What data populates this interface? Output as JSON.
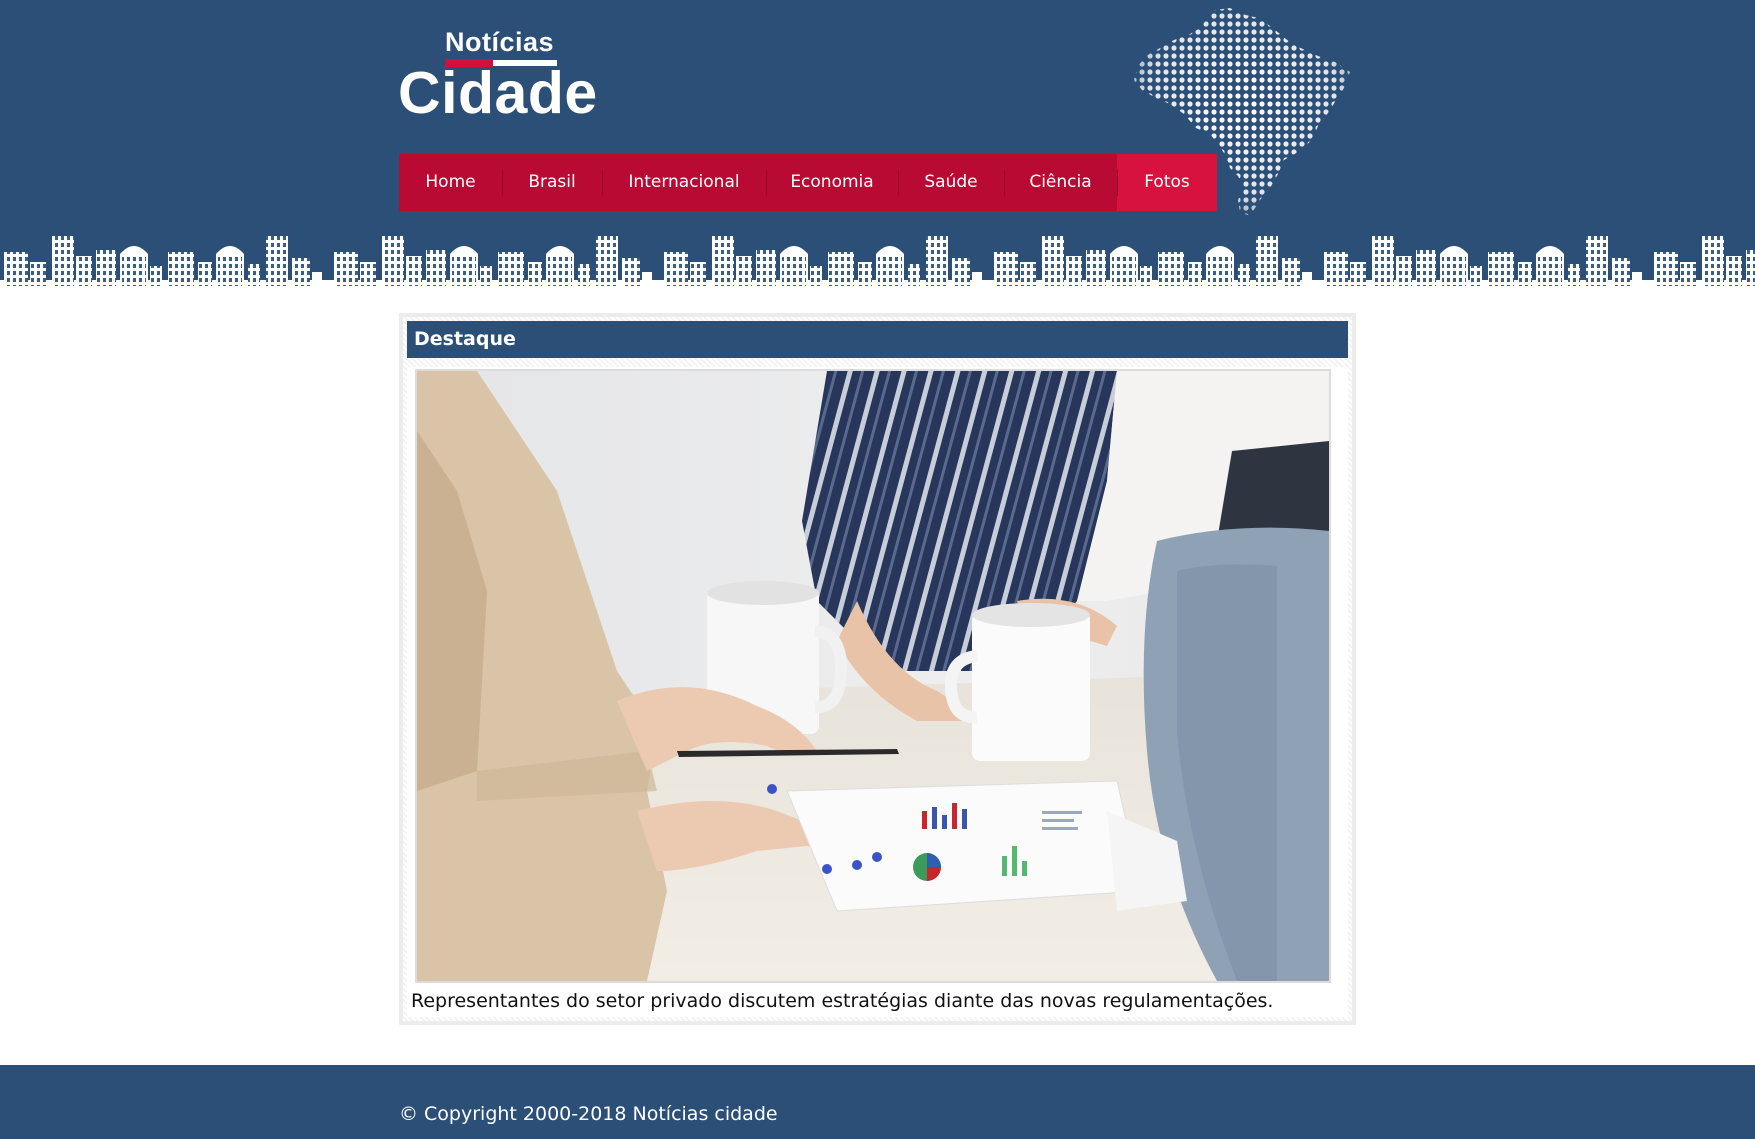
{
  "colors": {
    "header_bg": "#2b4f76",
    "nav_bg": "#b80a33",
    "nav_active": "#d8123f",
    "logo_accent": "#d40f3c",
    "footer_bg": "#2b4f76"
  },
  "header": {
    "logo": {
      "top_text": "Notícias",
      "main_text": "Cidade"
    },
    "decoration": [
      "brazil-map-dots",
      "city-skyline"
    ]
  },
  "nav": {
    "items": [
      {
        "label": "Home",
        "active": false
      },
      {
        "label": "Brasil",
        "active": false
      },
      {
        "label": "Internacional",
        "active": false
      },
      {
        "label": "Economia",
        "active": false
      },
      {
        "label": "Saúde",
        "active": false
      },
      {
        "label": "Ciência",
        "active": false
      },
      {
        "label": "Fotos",
        "active": true
      }
    ]
  },
  "featured": {
    "section_title": "Destaque",
    "caption": "Representantes do setor privado discutem estratégias diante das novas regulamentações."
  },
  "footer": {
    "copyright": "© Copyright 2000-2018 Notícias cidade"
  }
}
